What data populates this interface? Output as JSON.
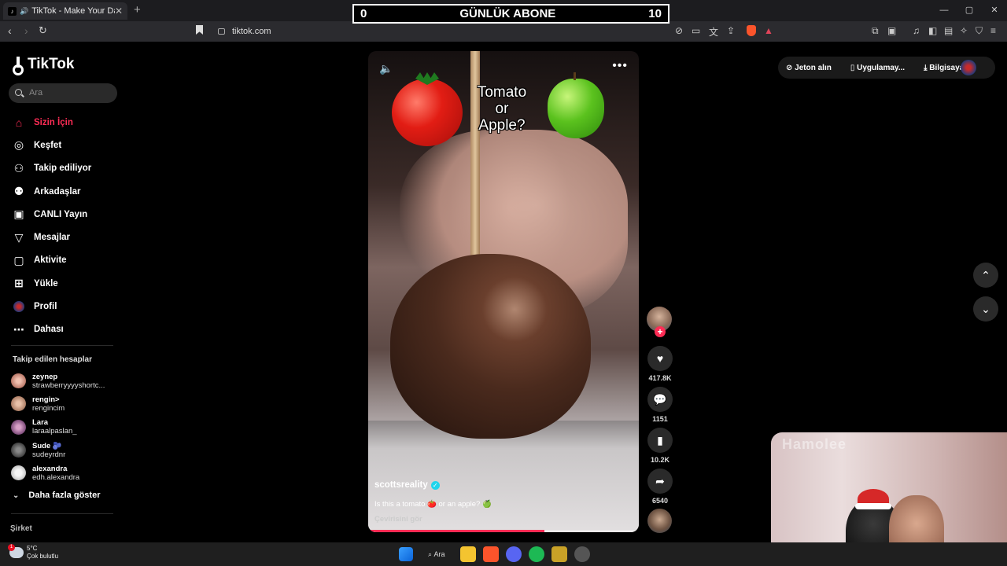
{
  "browser": {
    "tab_title": "TikTok - Make Your Day",
    "new_tab": "+",
    "url": "tiktok.com",
    "window_controls": [
      "—",
      "▢",
      "✕"
    ]
  },
  "overlay": {
    "left": "0",
    "title": "GÜNLÜK ABONE",
    "right": "10"
  },
  "sidebar": {
    "logo": "TikTok",
    "search_placeholder": "Ara",
    "menu": [
      {
        "label": "Sizin İçin",
        "icon": "home-icon"
      },
      {
        "label": "Keşfet",
        "icon": "compass-icon"
      },
      {
        "label": "Takip ediliyor",
        "icon": "following-icon"
      },
      {
        "label": "Arkadaşlar",
        "icon": "friends-icon"
      },
      {
        "label": "CANLI Yayın",
        "icon": "live-icon"
      },
      {
        "label": "Mesajlar",
        "icon": "message-icon"
      },
      {
        "label": "Aktivite",
        "icon": "activity-icon"
      },
      {
        "label": "Yükle",
        "icon": "upload-icon"
      },
      {
        "label": "Profil",
        "icon": "profile-icon"
      },
      {
        "label": "Dahası",
        "icon": "more-icon"
      }
    ],
    "following_title": "Takip edilen hesaplar",
    "following": [
      {
        "name": "zeynep",
        "handle": "strawberryyyyshortc..."
      },
      {
        "name": "rengin>",
        "handle": "rengincim"
      },
      {
        "name": "Lara",
        "handle": "laraalpaslan_"
      },
      {
        "name": "Sude 🫐",
        "handle": "sudeyrdnr"
      },
      {
        "name": "alexandra",
        "handle": "edh.alexandra"
      }
    ],
    "show_more": "Daha fazla göster",
    "company": "Şirket"
  },
  "video": {
    "overlay_text": "Tomato or Apple?",
    "author": "scottsreality",
    "description": "Is this a tomato 🍅 or an apple? 🍏",
    "translate": "Çevirisini gör",
    "progress_fraction": 0.65
  },
  "actions": {
    "likes": "417.8K",
    "comments": "1151",
    "saves": "10.2K",
    "shares": "6540"
  },
  "top_right": {
    "coins": "Jeton alın",
    "app": "Uygulamay...",
    "desktop": "Bilgisayar ..."
  },
  "webcam": {
    "watermark": "Hamolee"
  },
  "taskbar": {
    "temperature": "5°C",
    "weather": "Çok bulutlu",
    "search": "Ara"
  }
}
